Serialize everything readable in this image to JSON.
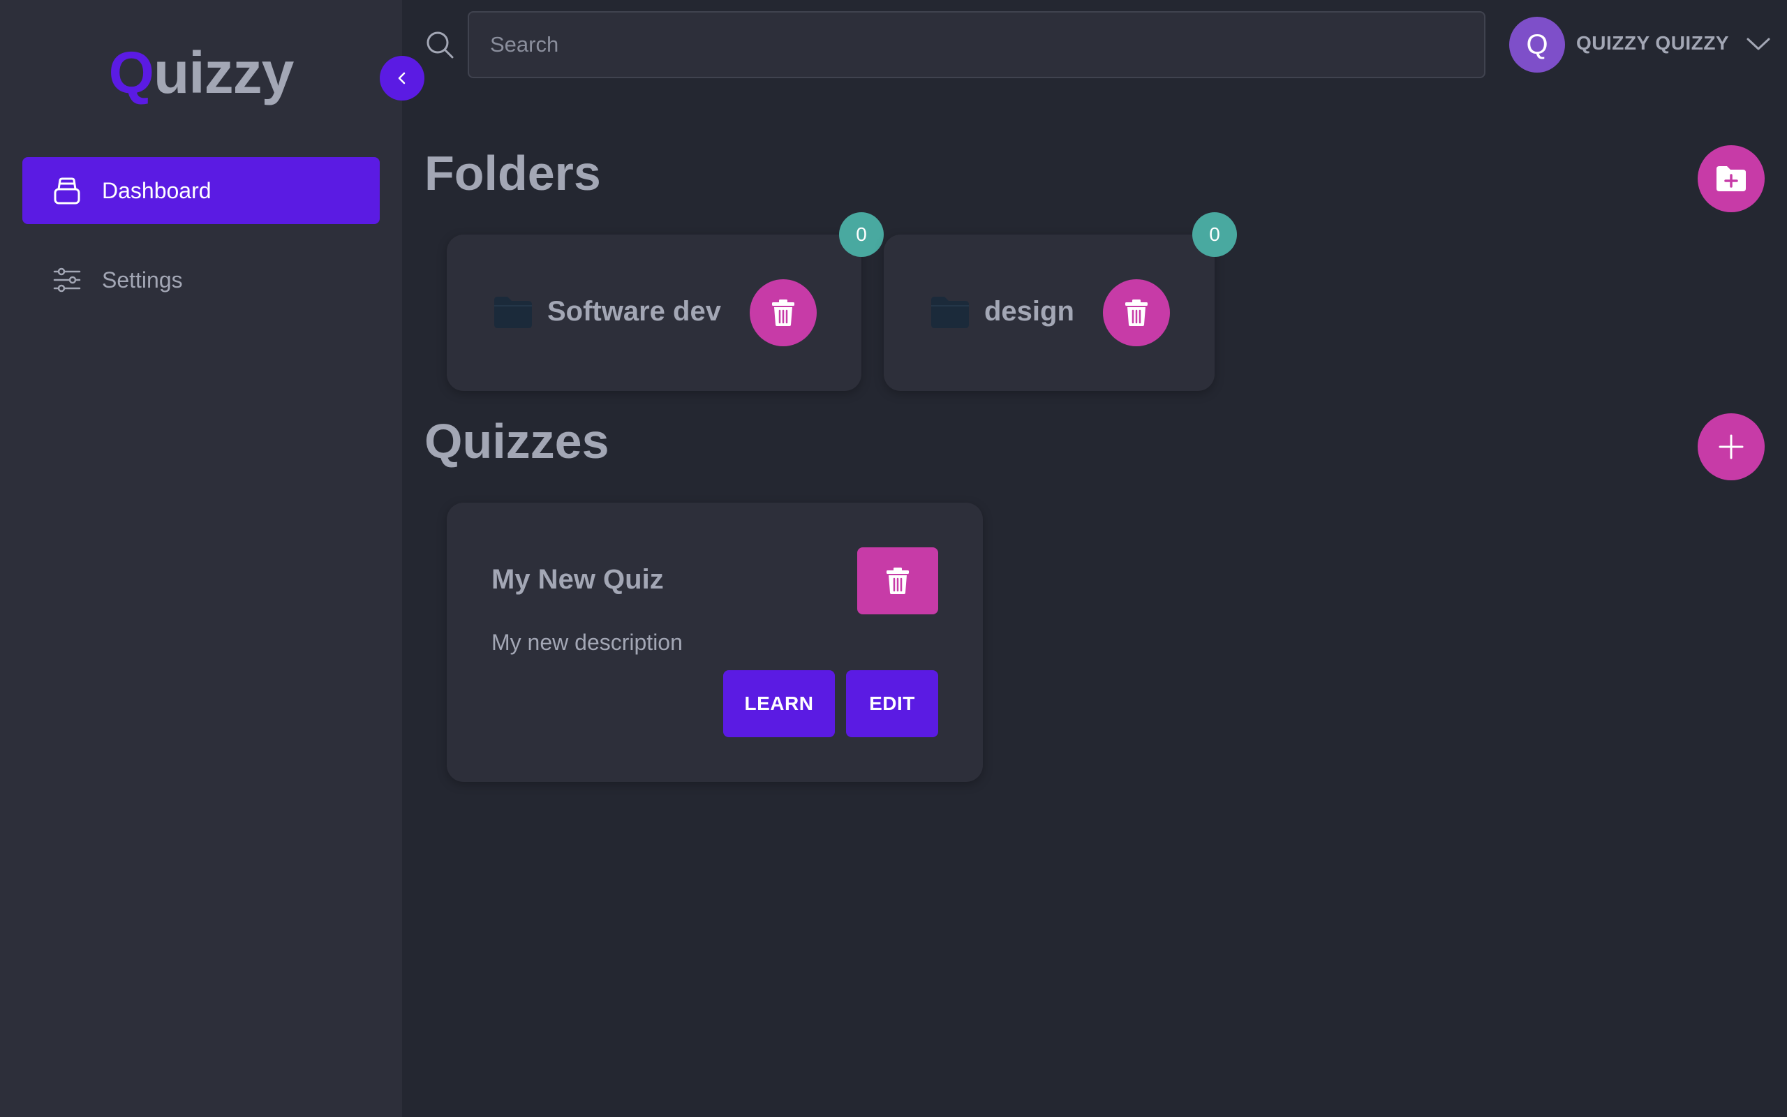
{
  "app": {
    "logo_first": "Q",
    "logo_rest": "uizzy"
  },
  "colors": {
    "accent": "#5b1be3",
    "danger": "#c73ba7",
    "badge": "#49a9a0",
    "avatar": "#7e4fc9",
    "background": "#242731",
    "surface": "#2d2f3a"
  },
  "sidebar": {
    "collapse_icon": "chevron-left-icon",
    "items": [
      {
        "label": "Dashboard",
        "icon": "inbox-icon",
        "active": true
      },
      {
        "label": "Settings",
        "icon": "sliders-icon",
        "active": false
      }
    ]
  },
  "header": {
    "search_placeholder": "Search",
    "search_icon": "search-icon",
    "avatar_letter": "Q",
    "user_name": "QUIZZY QUIZZY",
    "menu_icon": "chevron-down-icon"
  },
  "folders": {
    "title": "Folders",
    "add_icon": "folder-plus-icon",
    "items": [
      {
        "name": "Software dev",
        "count": "0",
        "icon": "folder-icon",
        "delete_icon": "trash-icon"
      },
      {
        "name": "design",
        "count": "0",
        "icon": "folder-icon",
        "delete_icon": "trash-icon"
      }
    ]
  },
  "quizzes": {
    "title": "Quizzes",
    "add_icon": "plus-icon",
    "items": [
      {
        "title": "My New Quiz",
        "description": "My new description",
        "learn_label": "LEARN",
        "edit_label": "EDIT",
        "delete_icon": "trash-icon"
      }
    ]
  }
}
